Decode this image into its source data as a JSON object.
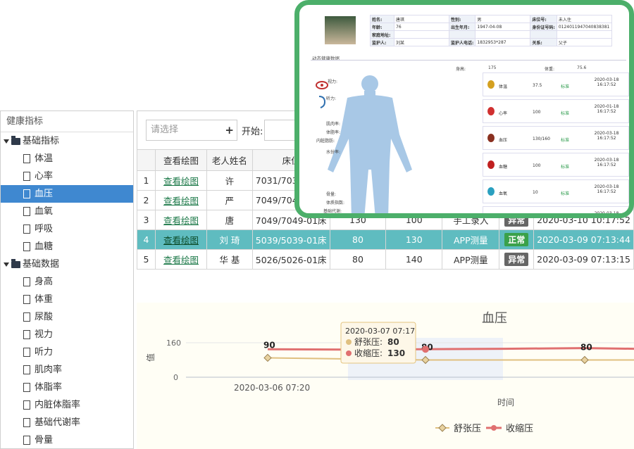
{
  "tree": {
    "header": "健康指标",
    "groups": [
      {
        "label": "基础指标",
        "items": [
          "体温",
          "心率",
          "血压",
          "血氧",
          "呼吸",
          "血糖"
        ]
      },
      {
        "label": "基础数据",
        "items": [
          "身高",
          "体重",
          "尿酸",
          "视力",
          "听力",
          "肌肉率",
          "体脂率",
          "内脏体脂率",
          "基础代谢率",
          "骨量"
        ]
      }
    ],
    "selected": "血压"
  },
  "toolbar": {
    "select_placeholder": "请选择",
    "plus": "+",
    "start_label": "开始:"
  },
  "table": {
    "headers": [
      "",
      "查看绘图",
      "老人姓名",
      "床位"
    ],
    "rows": [
      {
        "n": "1",
        "link": "查看绘图",
        "name": "许",
        "bed": "7031/703",
        "d": "",
        "s": "",
        "src": "",
        "status": "",
        "time": ""
      },
      {
        "n": "2",
        "link": "查看绘图",
        "name": "严",
        "bed": "7049/704",
        "d": "",
        "s": "",
        "src": "",
        "status": "",
        "time": ""
      },
      {
        "n": "3",
        "link": "查看绘图",
        "name": "唐",
        "bed": "7049/7049-01床",
        "d": "130",
        "s": "100",
        "src": "手工录入",
        "status": "异常",
        "time": "2020-03-10 10:17:52"
      },
      {
        "n": "4",
        "link": "查看绘图",
        "name": "刘 琦",
        "bed": "5039/5039-01床",
        "d": "80",
        "s": "130",
        "src": "APP测量",
        "status": "正常",
        "time": "2020-03-09 07:13:44"
      },
      {
        "n": "5",
        "link": "查看绘图",
        "name": "华 基",
        "bed": "5026/5026-01床",
        "d": "80",
        "s": "140",
        "src": "APP测量",
        "status": "异常",
        "time": "2020-03-09 07:13:15"
      }
    ]
  },
  "chart_data": {
    "type": "line",
    "title": "血压",
    "xlabel": "时间",
    "ylabel": "值",
    "yticks": [
      "160",
      "0"
    ],
    "ylim": [
      0,
      160
    ],
    "x_tick_label": "2020-03-06 07:20",
    "series": [
      {
        "name": "舒张压",
        "color": "#e0c080",
        "values": [
          90,
          80,
          80,
          80,
          80
        ]
      },
      {
        "name": "收缩压",
        "color": "#e07070",
        "values": [
          130,
          128,
          130,
          132,
          135,
          132
        ]
      }
    ],
    "data_labels": [
      "90",
      "80",
      "80"
    ],
    "tooltip": {
      "date": "2020-03-07 07:17",
      "rows": [
        {
          "label": "舒张压",
          "value": "80"
        },
        {
          "label": "收缩压",
          "value": "130"
        }
      ]
    }
  },
  "popup": {
    "info": [
      [
        "姓名:",
        "唐琪",
        "性别:",
        "男",
        "床位号:",
        "未入住"
      ],
      [
        "年龄:",
        "76",
        "出生年月:",
        "1947-04-08",
        "身份证号码:",
        "0124011947040838381"
      ],
      [
        "家庭地址:",
        "",
        "",
        "",
        "",
        ""
      ],
      [
        "监护人:",
        "刘某",
        "监护人电话:",
        "1832953*287",
        "关系:",
        "父子"
      ]
    ],
    "section": "动态健康数据",
    "height_label": "身高:",
    "height": "175",
    "weight_label": "体重:",
    "weight": "75.6",
    "left_labels": [
      "视力:",
      "听力:",
      "肌肉率:",
      "体脂率:",
      "内脏脂肪:",
      "水份率:",
      "骨量:",
      "体质指数:",
      "基础代谢:"
    ],
    "metrics": [
      {
        "name": "体温",
        "value": "37.5",
        "status": "标准",
        "time": "2020-03-18 16:17:52",
        "color": "#d4a020"
      },
      {
        "name": "心率",
        "value": "100",
        "status": "标准",
        "time": "2020-01-18 16:17:52",
        "color": "#d03030"
      },
      {
        "name": "血压",
        "value": "130/160",
        "status": "标准",
        "time": "2020-03-18 16:17:52",
        "color": "#8a3020"
      },
      {
        "name": "血糖",
        "value": "100",
        "status": "标准",
        "time": "2020-03-18 16:17:52",
        "color": "#c02020"
      },
      {
        "name": "血氧",
        "value": "10",
        "status": "标准",
        "time": "2020-03-18 16:17:52",
        "color": "#2aa0c0"
      },
      {
        "name": "总胆固醇",
        "value": "200",
        "status": "标准",
        "time": "2020-03-18 16:17:52",
        "color": "#a07010"
      }
    ]
  }
}
